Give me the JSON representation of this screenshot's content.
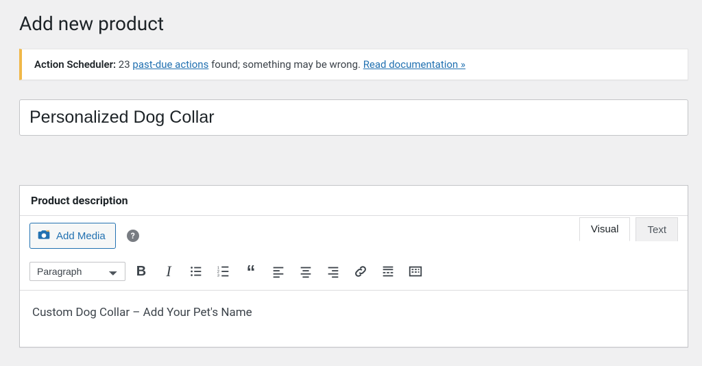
{
  "page_title": "Add new product",
  "notice": {
    "label": "Action Scheduler:",
    "count": "23",
    "link1": "past-due actions",
    "middle": "found; something may be wrong.",
    "link2": "Read documentation »"
  },
  "product_title": "Personalized Dog Collar",
  "editor": {
    "section_title": "Product description",
    "add_media": "Add Media",
    "tabs": {
      "visual": "Visual",
      "text": "Text"
    },
    "format": "Paragraph",
    "content": "Custom Dog Collar – Add Your Pet's Name"
  }
}
